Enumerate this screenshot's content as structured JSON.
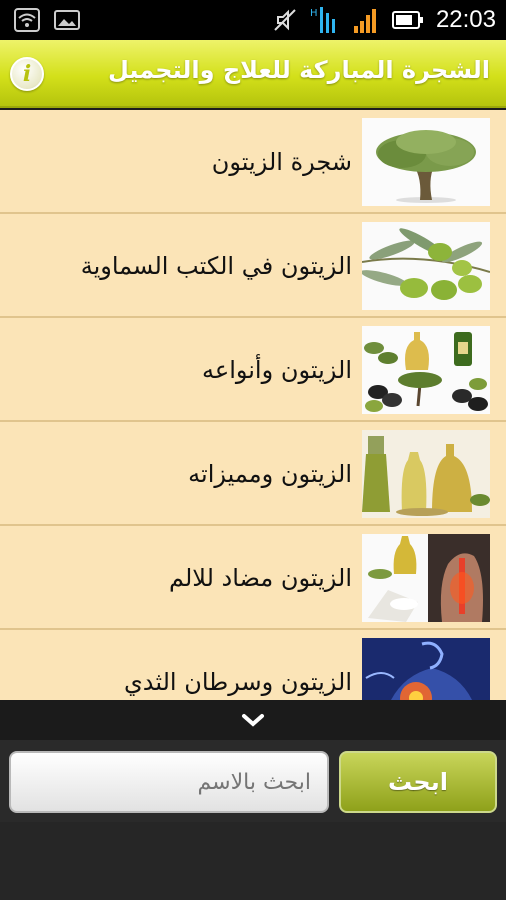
{
  "status_bar": {
    "time": "22:03",
    "icons": [
      "wifi-icon",
      "picture-icon",
      "mute-icon",
      "hd-data-icon",
      "signal-icon",
      "battery-icon"
    ]
  },
  "header": {
    "title": "الشجرة المباركة للعلاج والتجميل",
    "info_button": "i",
    "color": "#d3e01a"
  },
  "list": {
    "items": [
      {
        "label": "شجرة الزيتون",
        "thumb": "olive-tree-image"
      },
      {
        "label": "الزيتون في الكتب السماوية",
        "thumb": "olive-branch-image"
      },
      {
        "label": "الزيتون وأنواعه",
        "thumb": "olive-varieties-image"
      },
      {
        "label": "الزيتون ومميزاته",
        "thumb": "olive-oil-bottles-image"
      },
      {
        "label": "الزيتون مضاد للالم",
        "thumb": "back-pain-image"
      },
      {
        "label": "الزيتون وسرطان الثدي",
        "thumb": "breast-cancer-image"
      }
    ]
  },
  "search": {
    "placeholder": "ابحث بالاسم",
    "button_label": "ابحث"
  }
}
